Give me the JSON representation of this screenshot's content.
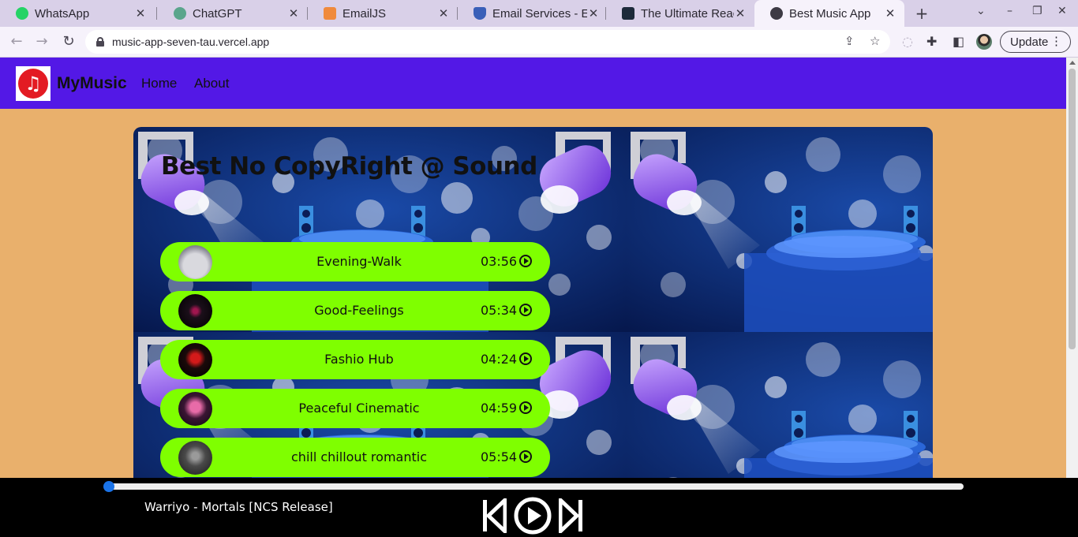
{
  "browser": {
    "tabs": [
      {
        "title": "WhatsApp",
        "icon": "whatsapp-icon",
        "color": "#25d366"
      },
      {
        "title": "ChatGPT",
        "icon": "chatgpt-icon",
        "color": "#5aa58c"
      },
      {
        "title": "EmailJS",
        "icon": "emailjs-icon",
        "color": "#f08a3c"
      },
      {
        "title": "Email Services - En",
        "icon": "emailjs-shield-icon",
        "color": "#3a5fb8"
      },
      {
        "title": "The Ultimate React",
        "icon": "react-icon",
        "color": "#1d2a3a"
      },
      {
        "title": "Best Music App",
        "icon": "globe-icon",
        "color": "#3d3a44"
      }
    ],
    "active_tab": 5,
    "url": "music-app-seven-tau.vercel.app",
    "update_label": "Update"
  },
  "navbar": {
    "brand": "MyMusic",
    "links": [
      "Home",
      "About"
    ],
    "bg_color": "#5318e6"
  },
  "page": {
    "headline": "Best No CopyRight @ Sound",
    "songs": [
      {
        "title": "Evening-Walk",
        "duration": "03:56"
      },
      {
        "title": "Good-Feelings",
        "duration": "05:34"
      },
      {
        "title": "Fashio Hub",
        "duration": "04:24"
      },
      {
        "title": "Peaceful Cinematic",
        "duration": "04:59"
      },
      {
        "title": "chill chillout romantic",
        "duration": "05:54"
      }
    ],
    "song_bg_color": "#7fff00"
  },
  "player": {
    "now_playing": "Warriyo - Mortals [NCS Release]",
    "progress": 0
  }
}
